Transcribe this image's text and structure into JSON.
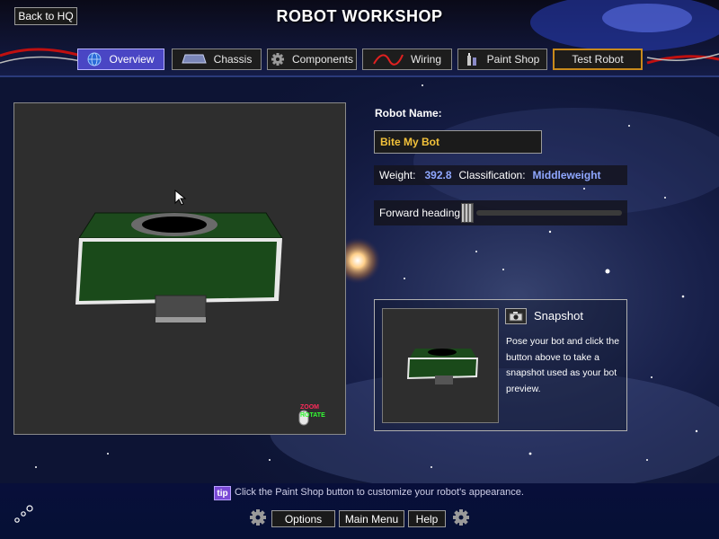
{
  "header": {
    "back_label": "Back to HQ",
    "title": "ROBOT WORKSHOP"
  },
  "tabs": [
    {
      "label": "Overview",
      "icon": "globe-icon",
      "active": true
    },
    {
      "label": "Chassis",
      "icon": "chassis-icon"
    },
    {
      "label": "Components",
      "icon": "gear-icon"
    },
    {
      "label": "Wiring",
      "icon": "wire-icon"
    },
    {
      "label": "Paint Shop",
      "icon": "paint-icon"
    },
    {
      "label": "Test Robot",
      "icon": ""
    }
  ],
  "viewport": {
    "zoom_label": "ZOOM",
    "rotate_label": "ROTATE"
  },
  "robot": {
    "name_label": "Robot Name:",
    "name_value": "Bite My Bot",
    "weight_label": "Weight:",
    "weight_value": "392.8",
    "class_label": "Classification:",
    "class_value": "Middleweight",
    "heading_label": "Forward heading:"
  },
  "snapshot": {
    "title": "Snapshot",
    "description": "Pose your bot and click the button above to take a snapshot used as your bot preview."
  },
  "footer": {
    "tip_badge": "tip",
    "tip_text": "Click the Paint Shop button to customize your robot's appearance.",
    "options_label": "Options",
    "main_menu_label": "Main Menu",
    "help_label": "Help"
  },
  "colors": {
    "accent": "#4a46c4",
    "name_text": "#f3c23a",
    "stat_value": "#8fa7ff",
    "chassis_green": "#1a4a1a"
  }
}
